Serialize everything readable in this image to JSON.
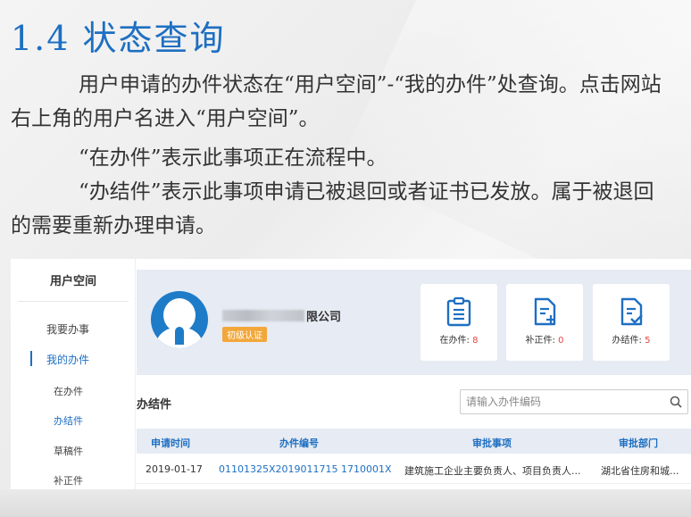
{
  "slide": {
    "title": "1.4 状态查询",
    "para1": "用户申请的办件状态在“用户空间”-“我的办件”处查询。点击网站右上角的用户名进入“用户空间”。",
    "para2": "“在办件”表示此事项正在流程中。",
    "para3": "“办结件”表示此事项申请已被退回或者证书已发放。属于被退回的需要重新办理申请。"
  },
  "sidebar": {
    "title": "用户空间",
    "items": [
      {
        "label": "我要办事"
      },
      {
        "label": "我的办件"
      },
      {
        "label": "在办件"
      },
      {
        "label": "办结件"
      },
      {
        "label": "草稿件"
      },
      {
        "label": "补正件"
      }
    ]
  },
  "profile": {
    "company_suffix": "限公司",
    "badge": "初级认证"
  },
  "stats": [
    {
      "label": "在办件: ",
      "count": "8",
      "icon": "clipboard-list-icon"
    },
    {
      "label": "补正件: ",
      "count": "0",
      "icon": "document-plus-icon"
    },
    {
      "label": "办结件: ",
      "count": "5",
      "icon": "document-check-icon"
    }
  ],
  "list": {
    "title": "办结件",
    "search_placeholder": "请输入办件编码",
    "columns": [
      "申请时间",
      "办件编号",
      "审批事项",
      "审批部门"
    ],
    "rows": [
      {
        "date": "2019-01-17",
        "code": "01101325X2019011715  1710001X",
        "item": "建筑施工企业主要负责人、项目负责人...",
        "dept": "湖北省住房和城..."
      }
    ]
  },
  "colors": {
    "accent": "#1e6fc2",
    "badge": "#f3a73a",
    "count": "#e54545"
  }
}
